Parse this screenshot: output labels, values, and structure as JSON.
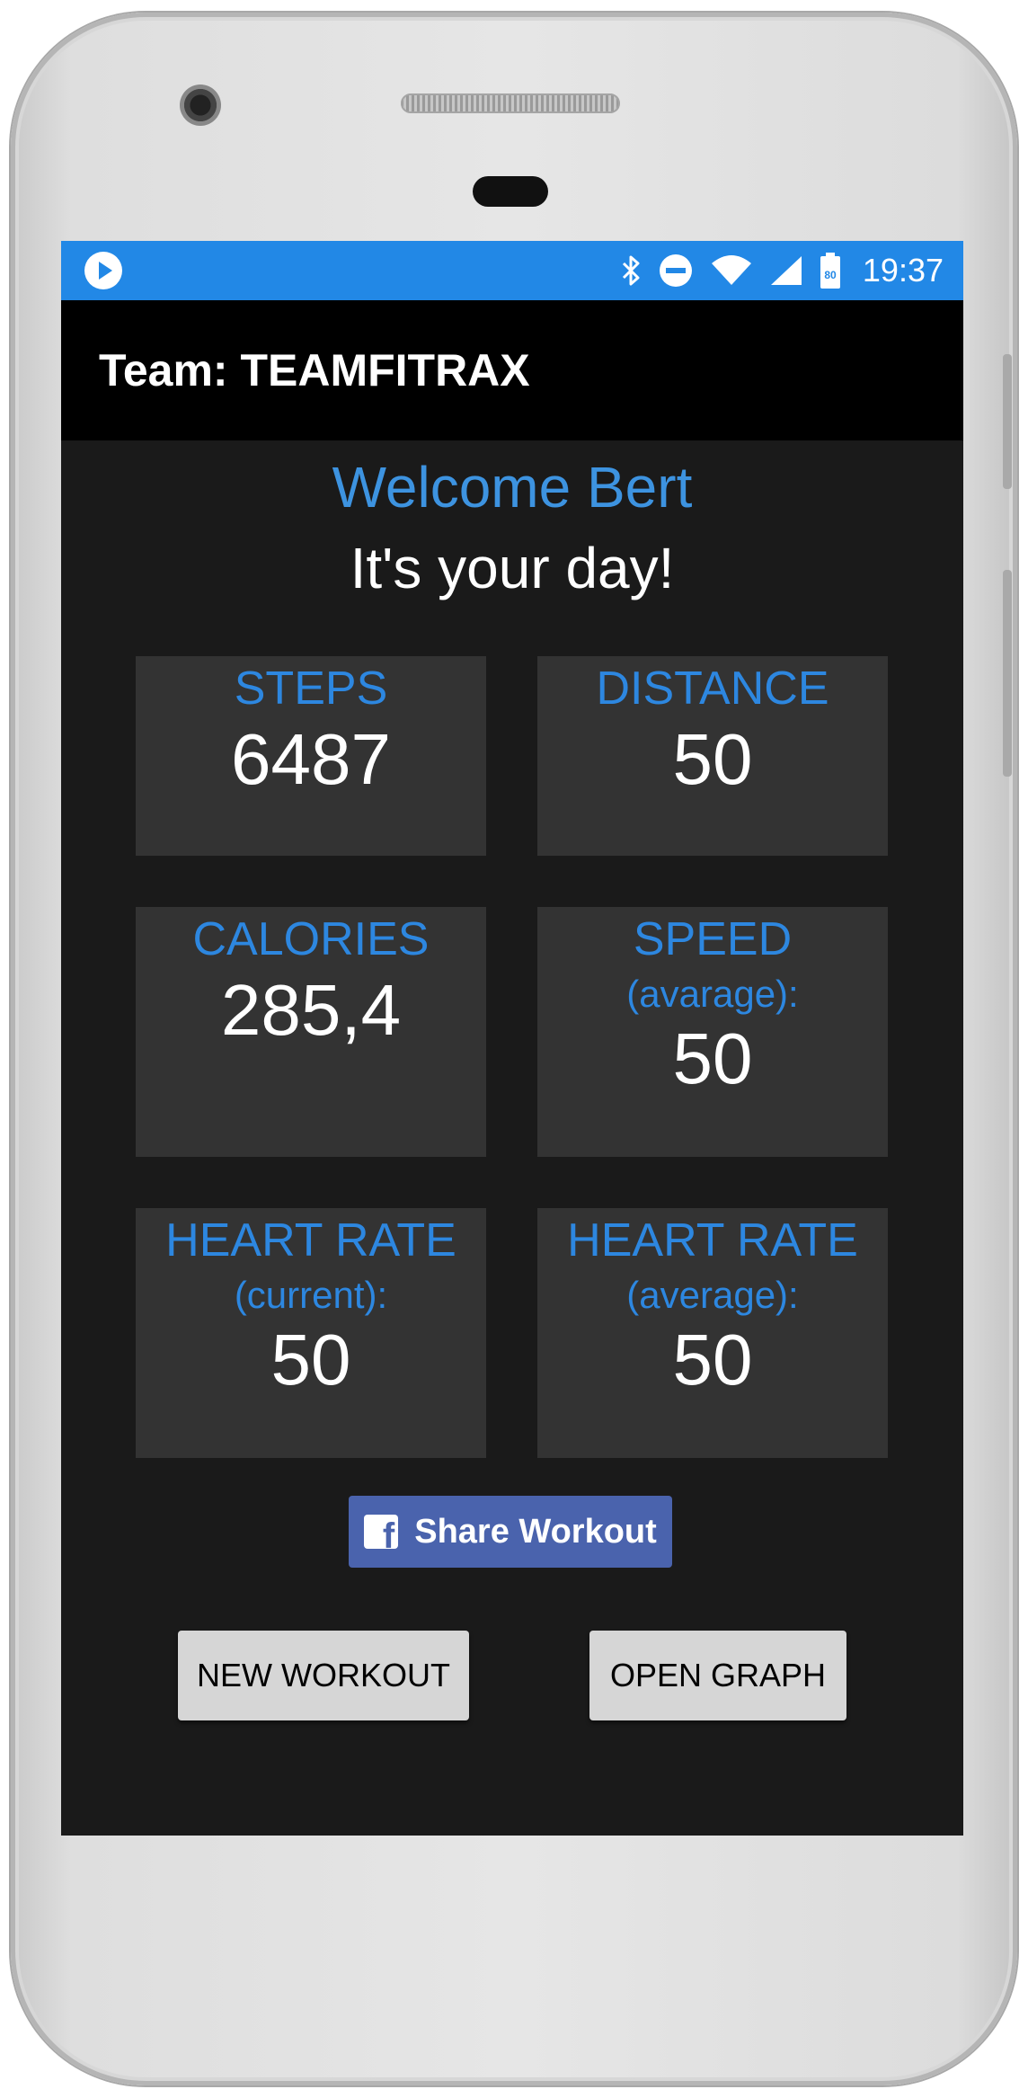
{
  "status_bar": {
    "time": "19:37",
    "battery_level": "80",
    "icons": [
      "play-icon",
      "bluetooth-icon",
      "do-not-disturb-icon",
      "wifi-icon",
      "cell-signal-icon",
      "battery-icon"
    ],
    "color": "#2288e6"
  },
  "app_bar": {
    "title": "Team: TEAMFITRAX"
  },
  "greeting": {
    "welcome": "Welcome Bert",
    "tagline": "It's your day!"
  },
  "stats": {
    "steps": {
      "label": "STEPS",
      "value": "6487"
    },
    "distance": {
      "label": "DISTANCE",
      "value": "50"
    },
    "calories": {
      "label": "CALORIES",
      "value": "285,4"
    },
    "speed": {
      "label": "SPEED",
      "sub": "(avarage):",
      "value": "50"
    },
    "heart_current": {
      "label": "HEART RATE",
      "sub": "(current):",
      "value": "50"
    },
    "heart_average": {
      "label": "HEART RATE",
      "sub": "(average):",
      "value": "50"
    }
  },
  "share_button": {
    "label": "Share Workout",
    "icon": "facebook-icon",
    "color": "#4a63ad"
  },
  "actions": {
    "new_workout": "NEW WORKOUT",
    "open_graph": "OPEN GRAPH"
  },
  "colors": {
    "accent": "#2d87e0",
    "background": "#1a1a1a",
    "card": "#333333"
  }
}
